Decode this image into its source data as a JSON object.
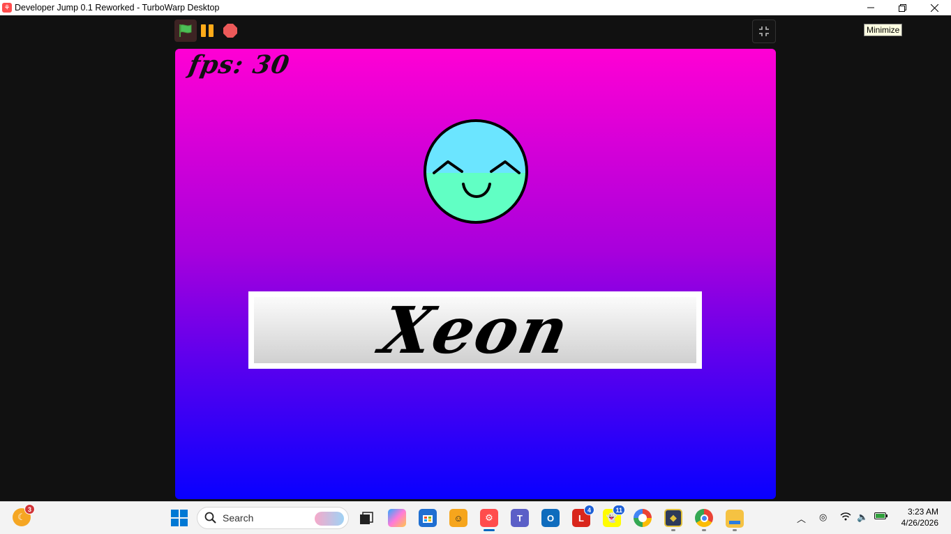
{
  "window": {
    "title": "Developer Jump 0.1 Reworked - TurboWarp Desktop",
    "minimize_tooltip": "Minimize",
    "app_icon_glyph": "⚘"
  },
  "stage": {
    "fps_text": "fps: 30",
    "player_name": "Xeon",
    "colors": {
      "top": "#ff00d4",
      "bottom": "#0800ff",
      "face_top": "#6be5ff",
      "face_bottom": "#61ffc4"
    }
  },
  "taskbar": {
    "search_placeholder": "Search",
    "weather_badge": "3",
    "apps": [
      {
        "name": "start",
        "icon": "windows-logo-icon"
      },
      {
        "name": "task-view",
        "icon": "task-view-icon"
      },
      {
        "name": "copilot",
        "icon": "copilot-icon"
      },
      {
        "name": "store",
        "icon": "store-icon"
      },
      {
        "name": "scratch-cat",
        "icon": "scratch-cat-icon"
      },
      {
        "name": "turbowarp",
        "icon": "turbowarp-icon"
      },
      {
        "name": "teams",
        "icon": "teams-icon"
      },
      {
        "name": "outlook",
        "icon": "outlook-icon"
      },
      {
        "name": "l-app",
        "icon": "l-app-icon",
        "badge": "4",
        "label": "L"
      },
      {
        "name": "snapchat",
        "icon": "snapchat-icon",
        "badge": "11"
      },
      {
        "name": "app-circle",
        "icon": "circle-app-icon"
      },
      {
        "name": "game-app",
        "icon": "game-app-icon"
      },
      {
        "name": "chrome",
        "icon": "chrome-icon"
      },
      {
        "name": "file-explorer",
        "icon": "folder-icon"
      }
    ],
    "clock_time": "3:23 AM",
    "clock_date": "4/26/2026"
  }
}
